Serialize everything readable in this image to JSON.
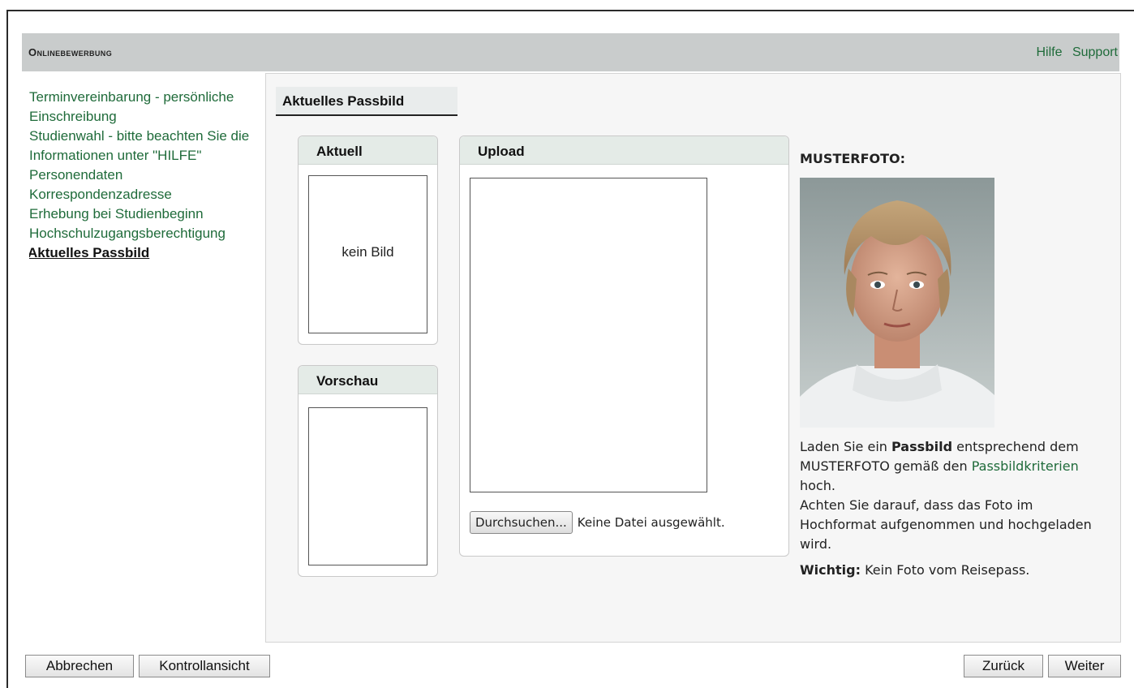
{
  "header": {
    "title": "Onlinebewerbung",
    "links": [
      "Hilfe",
      "Support"
    ]
  },
  "nav": {
    "items": [
      "Terminvereinbarung - persönliche Einschreibung",
      "Studienwahl - bitte beachten Sie die Informationen unter \"HILFE\"",
      "Personendaten",
      "Korrespondenzadresse",
      "Erhebung bei Studienbeginn",
      "Hochschulzugangsberechtigung"
    ],
    "active": "Aktuelles Passbild"
  },
  "tab": {
    "label": "Aktuelles Passbild"
  },
  "current_box": {
    "title": "Aktuell",
    "placeholder": "kein Bild"
  },
  "preview_box": {
    "title": "Vorschau"
  },
  "upload_box": {
    "title": "Upload",
    "browse_label": "Durchsuchen...",
    "file_status": "Keine Datei ausgewählt."
  },
  "info": {
    "sample_title": "MUSTERFOTO:",
    "line_pre": "Laden Sie ein ",
    "bold_word": "Passbild",
    "line_mid": " entsprechend dem MUSTERFOTO gemäß den ",
    "link_text": "Passbildkriterien",
    "line_post": " hoch.",
    "line2": "Achten Sie darauf, dass das Foto im Hochformat aufgenommen und hochgeladen wird.",
    "important_label": "Wichtig:",
    "important_text": " Kein Foto vom Reisepass."
  },
  "footer": {
    "cancel": "Abbrechen",
    "control_view": "Kontrollansicht",
    "back": "Zurück",
    "next": "Weiter"
  }
}
